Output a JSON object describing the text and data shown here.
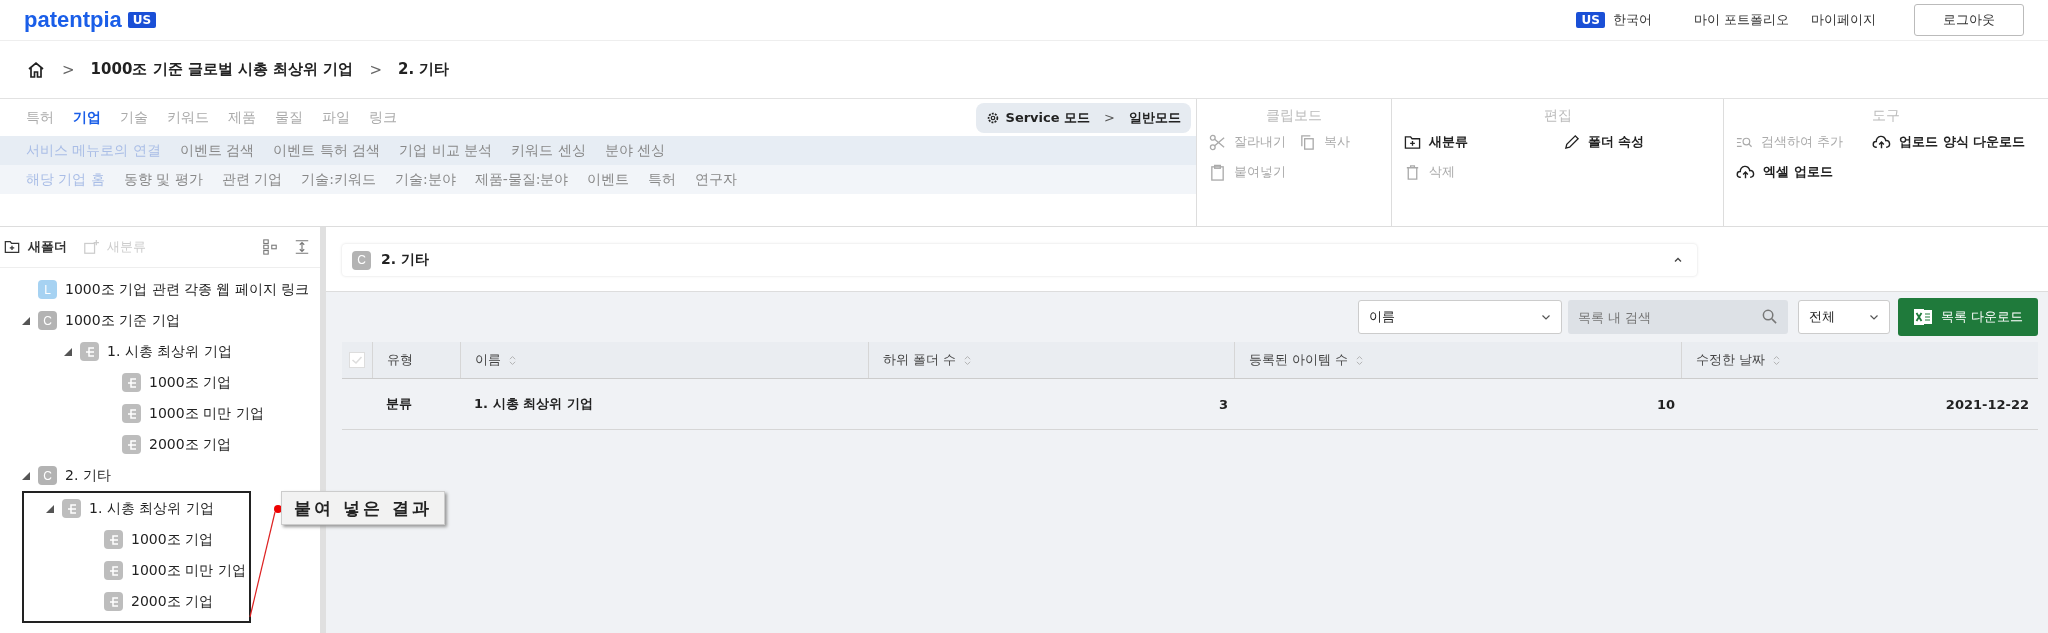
{
  "header": {
    "logo": "patentpia",
    "logo_badge": "US",
    "lang_badge": "US",
    "language": "한국어",
    "links": [
      "마이 포트폴리오",
      "마이페이지"
    ],
    "logout": "로그아웃"
  },
  "breadcrumb": {
    "separator": ">",
    "items": [
      "1000조 기준 글로벌 시총 최상위 기업",
      "2. 기타"
    ]
  },
  "ribbon": {
    "tabs": [
      {
        "label": "특허",
        "selected": false
      },
      {
        "label": "기업",
        "selected": true
      },
      {
        "label": "기술",
        "selected": false
      },
      {
        "label": "키워드",
        "selected": false
      },
      {
        "label": "제품",
        "selected": false
      },
      {
        "label": "물질",
        "selected": false
      },
      {
        "label": "파일",
        "selected": false
      },
      {
        "label": "링크",
        "selected": false
      }
    ],
    "mode": {
      "selected": true,
      "label": "Service 모드",
      "separator": ">",
      "value": "일반모드"
    },
    "rows": [
      {
        "label": "서비스 메뉴로의 연결",
        "items": [
          "이벤트 검색",
          "이벤트 특허 검색",
          "기업 비교 분석",
          "키워드 센싱",
          "분야 센싱"
        ]
      },
      {
        "label": "해당 기업 홈",
        "items": [
          "동향 및 평가",
          "관련 기업",
          "기술:키워드",
          "기술:분야",
          "제품-물질:분야",
          "이벤트",
          "특허",
          "연구자"
        ]
      }
    ],
    "groups": [
      {
        "title": "클립보드",
        "buttons": [
          {
            "label": "잘라내기",
            "disabled": true
          },
          {
            "label": "복사",
            "disabled": true
          },
          {
            "label": "붙여넣기",
            "disabled": true
          }
        ]
      },
      {
        "title": "편집",
        "buttons": [
          {
            "label": "새분류",
            "disabled": false
          },
          {
            "label": "폴더 속성",
            "disabled": false
          },
          {
            "label": "삭제",
            "disabled": true
          }
        ]
      },
      {
        "title": "도구",
        "buttons": [
          {
            "label": "검색하여 추가",
            "disabled": true
          },
          {
            "label": "업로드 양식 다운로드",
            "disabled": false
          },
          {
            "label": "엑셀 업로드",
            "disabled": false
          }
        ]
      }
    ]
  },
  "sidebar": {
    "buttons": [
      {
        "label": "새폴더",
        "disabled": false
      },
      {
        "label": "새분류",
        "disabled": true
      }
    ],
    "tree": [
      {
        "kind": "link",
        "badge": "L",
        "label": "1000조 기업 관련 각종 웹 페이지 링크"
      },
      {
        "kind": "collection",
        "badge": "C",
        "label": "1000조 기준 기업",
        "expanded": true,
        "children": [
          {
            "kind": "category",
            "label": "1. 시총 최상위 기업",
            "expanded": true,
            "children": [
              {
                "kind": "category",
                "label": "1000조 기업"
              },
              {
                "kind": "category",
                "label": "1000조 미만 기업"
              },
              {
                "kind": "category",
                "label": "2000조 기업"
              }
            ]
          }
        ]
      },
      {
        "kind": "collection",
        "badge": "C",
        "label": "2. 기타",
        "expanded": true,
        "children": [
          {
            "kind": "category",
            "label": "1. 시총 최상위 기업",
            "expanded": true,
            "children": [
              {
                "kind": "category",
                "label": "1000조 기업"
              },
              {
                "kind": "category",
                "label": "1000조 미만 기업"
              },
              {
                "kind": "category",
                "label": "2000조 기업"
              }
            ]
          }
        ]
      }
    ]
  },
  "callout": {
    "text": "붙여 넣은 결과"
  },
  "folder": {
    "badge": "C",
    "title": "2. 기타"
  },
  "toolbar": {
    "field": "이름",
    "search_placeholder": "목록 내 검색",
    "filter": "전체",
    "download": "목록 다운로드"
  },
  "table": {
    "select_all": {
      "checked": true,
      "disabled": true
    },
    "columns": [
      "유형",
      "이름",
      "하위 폴더 수",
      "등록된 아이템 수",
      "수정한 날짜"
    ],
    "rows": [
      [
        "분류",
        "1. 시총 최상위 기업",
        "3",
        "10",
        "2021-12-22"
      ]
    ]
  }
}
